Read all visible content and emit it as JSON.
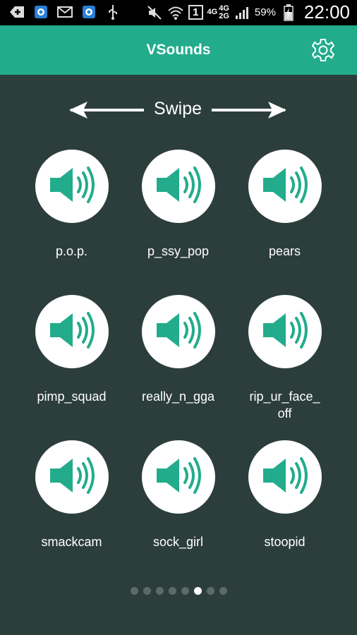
{
  "status_bar": {
    "battery": "59%",
    "time": "22:00",
    "network_a": "4G",
    "network_b": "4G",
    "network_c": "2G",
    "sim": "1",
    "icons": [
      "add-icon",
      "camera-app-icon",
      "mail-icon",
      "camera-app-icon",
      "usb-icon",
      "mute-icon",
      "wifi-icon",
      "sim-icon",
      "signal-icon",
      "battery-icon"
    ]
  },
  "app": {
    "title": "VSounds",
    "settings_icon": "gear-icon"
  },
  "swipe": {
    "label": "Swipe"
  },
  "sounds": [
    {
      "label": "p.o.p."
    },
    {
      "label": "p_ssy_pop"
    },
    {
      "label": "pears"
    },
    {
      "label": "pimp_squad"
    },
    {
      "label": "really_n_gga"
    },
    {
      "label": "rip_ur_face_off"
    },
    {
      "label": "smackcam"
    },
    {
      "label": "sock_girl"
    },
    {
      "label": "stoopid"
    }
  ],
  "pager": {
    "total": 8,
    "active_index": 5
  },
  "colors": {
    "accent": "#22ac8c",
    "background": "#2c3e3c",
    "icon": "#22ac8c"
  }
}
